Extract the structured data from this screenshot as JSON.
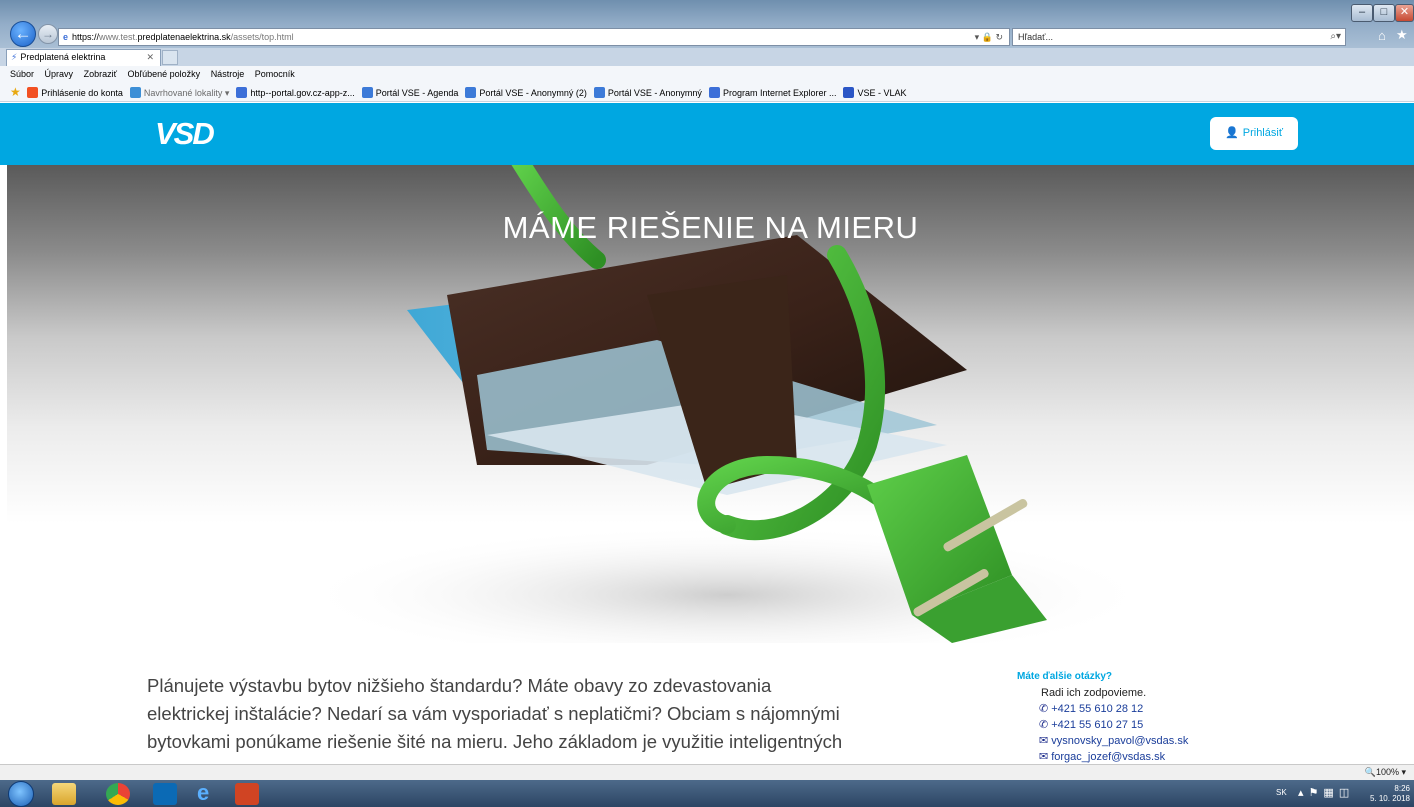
{
  "browser": {
    "address": {
      "scheme": "https://",
      "domain_prefix": "www.test.",
      "domain_main": "predplatenaelektrina.sk",
      "path": "/assets/top.html"
    },
    "search_placeholder": "Hľadať...",
    "tab_title": "Predplatená elektrina",
    "menu": [
      "Súbor",
      "Úpravy",
      "Zobraziť",
      "Obľúbené položky",
      "Nástroje",
      "Pomocník"
    ],
    "favorites": [
      {
        "label": "Prihlásenie do konta",
        "color": "#f25022"
      },
      {
        "label": "Navrhované lokality ▾",
        "color": "#3c8fd6",
        "gray": true
      },
      {
        "label": "http--portal.gov.cz-app-z...",
        "color": "#3c6fd8"
      },
      {
        "label": "Portál VSE - Agenda",
        "color": "#3c7ad8"
      },
      {
        "label": "Portál VSE - Anonymný (2)",
        "color": "#3c7ad8"
      },
      {
        "label": "Portál VSE - Anonymný",
        "color": "#3c7ad8"
      },
      {
        "label": "Program Internet Explorer ...",
        "color": "#3c6fd8"
      },
      {
        "label": "VSE - VLAK",
        "color": "#2b56c6"
      }
    ],
    "zoom": "100%"
  },
  "site": {
    "logo_text": "VSD",
    "login_label": "Prihlásiť",
    "hero_title": "MÁME RIEŠENIE NA MIERU",
    "body_lines": [
      "Plánujete výstavbu bytov nižšieho štandardu? Máte obavy zo zdevastovania",
      "elektrickej inštalácie? Nedarí sa vám vysporiadať s neplatičmi? Obciam s nájomnými",
      "bytovkami ponúkame riešenie šité na mieru. Jeho základom je využitie inteligentných"
    ],
    "contact": {
      "heading": "Máte ďalšie otázky?",
      "subheading": "Radi ich zodpovieme.",
      "phone_1": "+421 55 610 28 12",
      "phone_2": "+421 55 610 27 15",
      "email_1": "vysnovsky_pavol@vsdas.sk",
      "email_2": "forgac_jozef@vsdas.sk"
    }
  },
  "taskbar": {
    "language": "SK",
    "time": "8:26",
    "date": "5. 10. 2018"
  }
}
